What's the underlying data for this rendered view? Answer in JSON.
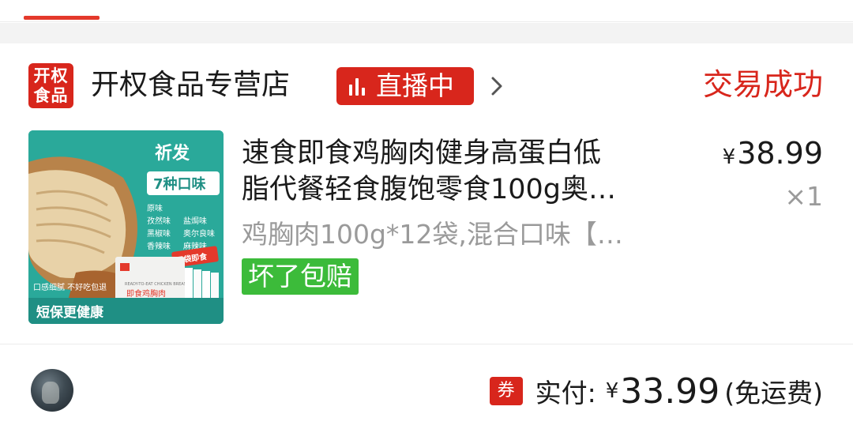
{
  "store": {
    "logo_line1": "开权",
    "logo_line2": "食品",
    "name": "开权食品专营店",
    "live_label": "直播中",
    "status": "交易成功"
  },
  "product": {
    "title_line1": "速食即食鸡胸肉健身高蛋白低",
    "title_line2": "脂代餐轻食腹饱零食100g奥…",
    "sku": "鸡胸肉100g*12袋,混合口味【…",
    "guarantee_tag": "坏了包赔",
    "price_currency": "¥",
    "price": "38.99",
    "quantity": "×1",
    "image": {
      "brand": "祈发",
      "flavors_badge": "7种口味",
      "flavors": [
        "原味",
        "孜然味",
        "盐焗味",
        "黑椒味",
        "奥尔良味",
        "香辣味",
        "麻辣味"
      ],
      "ready_tag": "开袋即食",
      "pack_text": "即食鸡胸肉",
      "pack_text_en": "READY-TO-EAT CHICKEN BREAST",
      "claim": "口感细腻  不好吃包退",
      "bottom_banner": "短保更健康"
    }
  },
  "footer": {
    "coupon_icon": "券",
    "pay_label": "实付:",
    "pay_currency": "¥",
    "pay_amount": "33.99",
    "pay_note": "(免运费)"
  },
  "colors": {
    "accent_red": "#d8261c",
    "guarantee_green": "#3cbb3a",
    "muted_text": "#9a9a9a"
  }
}
